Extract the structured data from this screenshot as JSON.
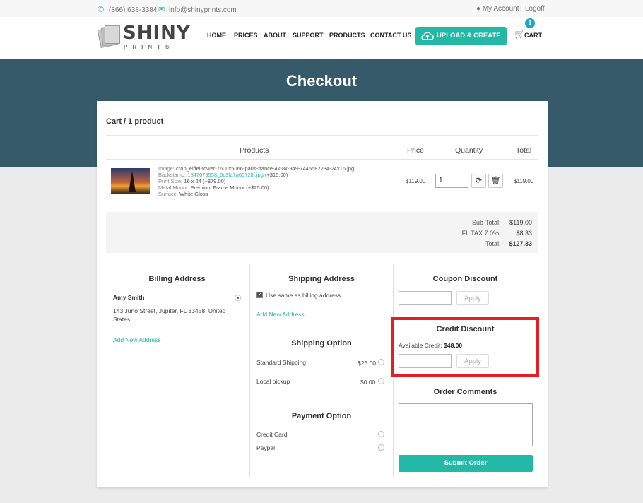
{
  "topbar": {
    "phone": "(866) 638-3384",
    "email": "info@shinyprints.com",
    "account": "My Account",
    "separator": "|",
    "logoff": "Logoff"
  },
  "header": {
    "brand_top": "SHINY",
    "brand_bottom": "PRINTS",
    "nav": [
      "HOME",
      "PRICES",
      "ABOUT",
      "SUPPORT",
      "PRODUCTS",
      "CONTACT US"
    ],
    "upload_label": "UPLOAD & CREATE",
    "cart_label": "CART",
    "cart_count": "1"
  },
  "page": {
    "title": "Checkout"
  },
  "cart": {
    "title": "Cart / 1 product",
    "headers": {
      "products": "Products",
      "price": "Price",
      "quantity": "Quantity",
      "total": "Total"
    },
    "item": {
      "image_label": "Image:",
      "image_value": "crop_eiffel-tower-7600x5066-paris-france-4k-8k-949-7445582234-24x16.jpg",
      "backstamp_label": "Backstamp:",
      "backstamp_value": "1547675558_5c3fa7a60728f.jpg",
      "backstamp_price": "(+$15.00)",
      "size_label": "Print Size:",
      "size_value": "16 x 24 (+$79.00)",
      "mount_label": "Metal Mount:",
      "mount_value": "Premium Frame Mount (+$25.00)",
      "surface_label": "Surface:",
      "surface_value": "White Gloss",
      "price": "$119.00",
      "quantity": "1",
      "total": "$119.00"
    },
    "totals": {
      "subtotal_label": "Sub-Total:",
      "subtotal_value": "$119.00",
      "tax_label": "FL TAX 7.0%:",
      "tax_value": "$8.33",
      "total_label": "Total:",
      "total_value": "$127.33"
    }
  },
  "billing": {
    "title": "Billing Address",
    "name": "Amy Smith",
    "address_line1": "143 Juno Street, Jupiter, FL 33458, United",
    "address_line2": "States",
    "add_link": "Add New Address"
  },
  "shipping": {
    "title": "Shipping Address",
    "same_label": "Use same as billing address",
    "add_link": "Add New Address",
    "option_title": "Shipping Option",
    "options": [
      {
        "label": "Standard Shipping",
        "price": "$25.00"
      },
      {
        "label": "Local pickup",
        "price": "$0.00"
      }
    ]
  },
  "payment": {
    "title": "Payment Option",
    "options": [
      "Credit Card",
      "Paypal"
    ]
  },
  "coupon": {
    "title": "Coupon Discount",
    "apply": "Apply"
  },
  "credit": {
    "title": "Credit Discount",
    "available_label": "Available Credit:",
    "available_value": "$48.00",
    "apply": "Apply"
  },
  "comments": {
    "title": "Order Comments"
  },
  "submit_label": "Submit Order",
  "colors": {
    "accent": "#24b9a6",
    "hero": "#375a6b",
    "highlight": "#e31e24"
  }
}
